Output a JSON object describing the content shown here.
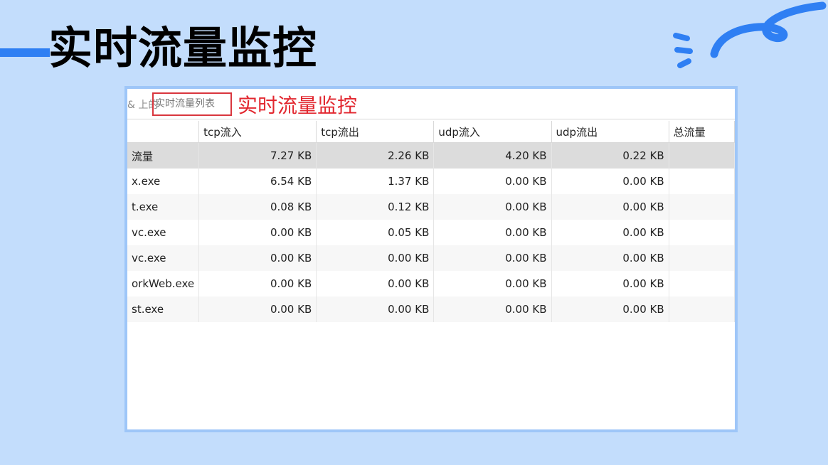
{
  "slide": {
    "title": "实时流量监控"
  },
  "screenshot": {
    "breadcrumb_prefix": "& 上的",
    "breadcrumb_box_label": "实时流量列表",
    "callout": "实时流量监控",
    "table": {
      "columns": [
        "",
        "tcp流入",
        "tcp流出",
        "udp流入",
        "udp流出",
        "总流量"
      ],
      "rows": [
        {
          "name": "流量",
          "tcp_in": "7.27 KB",
          "tcp_out": "2.26 KB",
          "udp_in": "4.20 KB",
          "udp_out": "0.22 KB",
          "total": ""
        },
        {
          "name": "x.exe",
          "tcp_in": "6.54 KB",
          "tcp_out": "1.37 KB",
          "udp_in": "0.00 KB",
          "udp_out": "0.00 KB",
          "total": ""
        },
        {
          "name": "t.exe",
          "tcp_in": "0.08 KB",
          "tcp_out": "0.12 KB",
          "udp_in": "0.00 KB",
          "udp_out": "0.00 KB",
          "total": ""
        },
        {
          "name": "vc.exe",
          "tcp_in": "0.00 KB",
          "tcp_out": "0.05 KB",
          "udp_in": "0.00 KB",
          "udp_out": "0.00 KB",
          "total": ""
        },
        {
          "name": "vc.exe",
          "tcp_in": "0.00 KB",
          "tcp_out": "0.00 KB",
          "udp_in": "0.00 KB",
          "udp_out": "0.00 KB",
          "total": ""
        },
        {
          "name": "orkWeb.exe",
          "tcp_in": "0.00 KB",
          "tcp_out": "0.00 KB",
          "udp_in": "0.00 KB",
          "udp_out": "0.00 KB",
          "total": ""
        },
        {
          "name": "st.exe",
          "tcp_in": "0.00 KB",
          "tcp_out": "0.00 KB",
          "udp_in": "0.00 KB",
          "udp_out": "0.00 KB",
          "total": ""
        }
      ]
    }
  },
  "colors": {
    "background": "#c3ddfc",
    "accent_line": "#2f7ff3",
    "frame_border": "#9ec6f8",
    "callout_red": "#e2272f",
    "total_row_bg": "#dcdcdc"
  },
  "icons": {
    "decoration": "squiggle-swirl-icon"
  }
}
